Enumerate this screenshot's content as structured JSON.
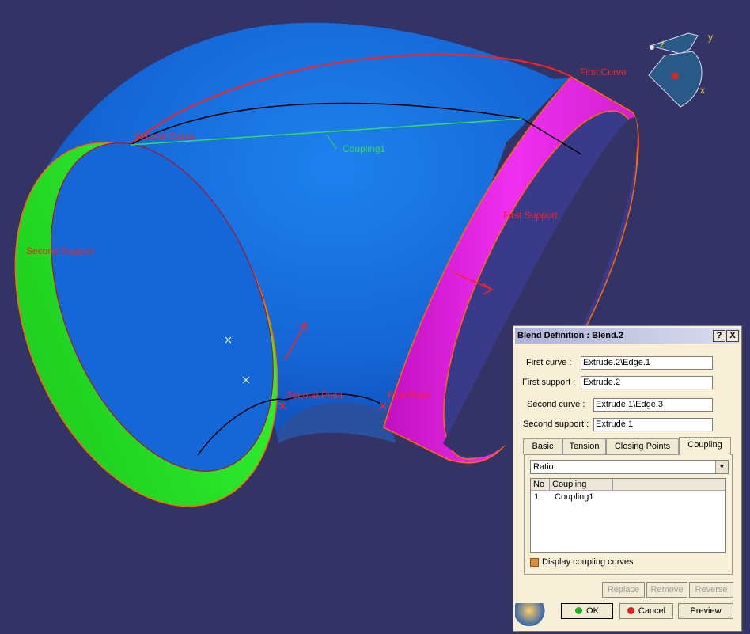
{
  "viewport": {
    "labels": {
      "first_curve": "First Curve",
      "second_curve": "Second Curve",
      "coupling": "Coupling1",
      "first_support": "First Support",
      "second_support": "Second Support",
      "first_point": "First Point",
      "second_point": "Second Point"
    },
    "compass": {
      "x": "x",
      "y": "y",
      "z": "z"
    },
    "colors": {
      "background": "#333366",
      "surface": "#1a75e6",
      "first_support": "#e01ee0",
      "second_support": "#22ee22",
      "curve": "#ff2020",
      "coupling_line": "#33dd55"
    }
  },
  "dialog": {
    "title": "Blend Definition : Blend.2",
    "help_label": "?",
    "close_label": "X",
    "first_curve_label": "First curve :",
    "first_curve_value": "Extrude.2\\Edge.1",
    "first_support_label": "First support :",
    "first_support_value": "Extrude.2",
    "second_curve_label": "Second curve :",
    "second_curve_value": "Extrude.1\\Edge.3",
    "second_support_label": "Second support :",
    "second_support_value": "Extrude.1",
    "tabs": [
      "Basic",
      "Tension",
      "Closing Points",
      "Coupling"
    ],
    "coupling_mode": "Ratio",
    "table": {
      "columns": [
        "No",
        "Coupling"
      ],
      "rows": [
        {
          "no": "1",
          "coupling": "Coupling1"
        }
      ]
    },
    "display_coupling_label": "Display coupling curves",
    "replace_label": "Replace",
    "remove_label": "Remove",
    "reverse_label": "Reverse",
    "ok_label": "OK",
    "cancel_label": "Cancel",
    "preview_label": "Preview"
  }
}
